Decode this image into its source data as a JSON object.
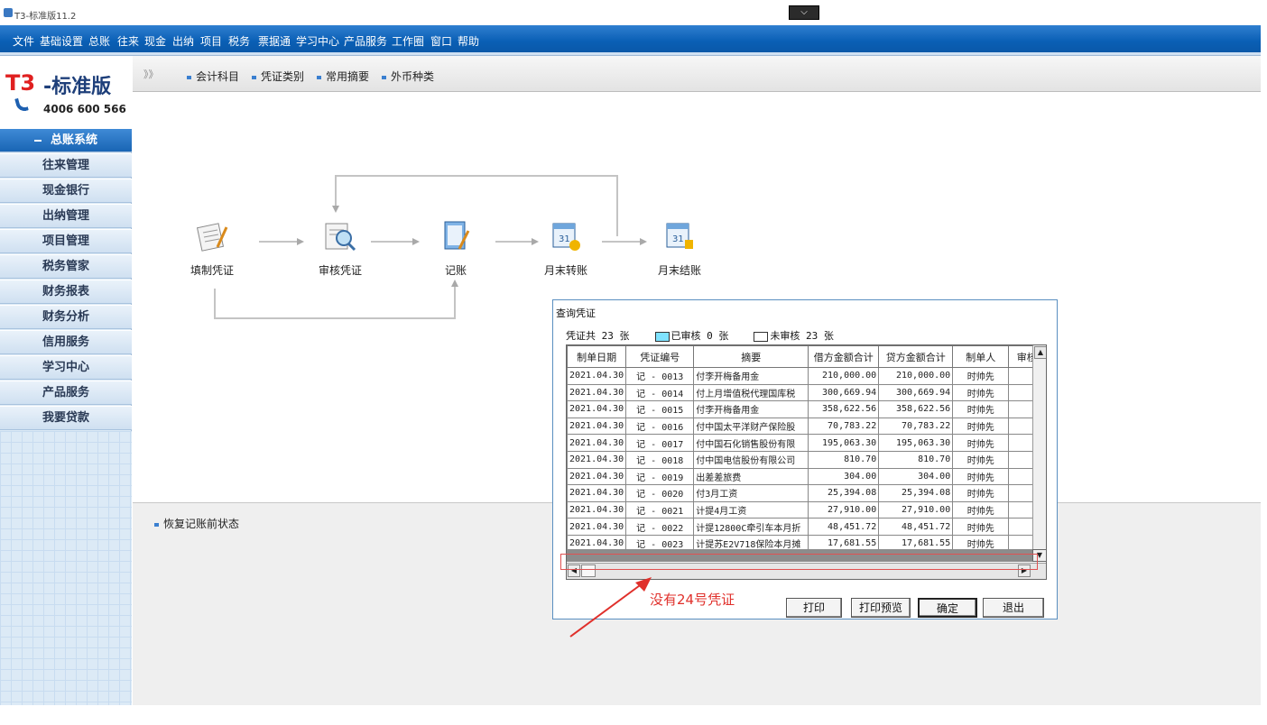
{
  "window": {
    "title": "T3-标准版11.2",
    "dropdown_glyph": "⌵"
  },
  "menu": [
    "文件",
    "基础设置",
    "总账",
    "往来",
    "现金",
    "出纳",
    "项目",
    "税务",
    "票据通",
    "学习中心",
    "产品服务",
    "工作圈",
    "窗口",
    "帮助"
  ],
  "logo": {
    "t3": "T3",
    "rest": "-标准版",
    "phone": "4006 600 566"
  },
  "sidebar": {
    "items": [
      {
        "label": "总账系统",
        "active": true
      },
      {
        "label": "往来管理"
      },
      {
        "label": "现金银行"
      },
      {
        "label": "出纳管理"
      },
      {
        "label": "项目管理"
      },
      {
        "label": "税务管家"
      },
      {
        "label": "财务报表"
      },
      {
        "label": "财务分析"
      },
      {
        "label": "信用服务"
      },
      {
        "label": "学习中心"
      },
      {
        "label": "产品服务"
      },
      {
        "label": "我要贷款"
      }
    ]
  },
  "toolbar": {
    "arrows": "》》",
    "links": [
      "会计科目",
      "凭证类别",
      "常用摘要",
      "外币种类"
    ]
  },
  "workflow": {
    "nodes": [
      "填制凭证",
      "审核凭证",
      "记账",
      "月末转账",
      "月末结账"
    ]
  },
  "lower": {
    "restore_label": "恢复记账前状态"
  },
  "dialog": {
    "title": "查询凭证",
    "stats": {
      "total": "凭证共 23 张",
      "audited": "已审核 0 张",
      "unaudited": "未审核 23 张"
    },
    "columns": [
      "制单日期",
      "凭证编号",
      "摘要",
      "借方金额合计",
      "贷方金额合计",
      "制单人",
      "审核"
    ],
    "rows": [
      [
        "2021.04.30",
        "记 - 0013",
        "付李开梅备用金",
        "210,000.00",
        "210,000.00",
        "时帅先"
      ],
      [
        "2021.04.30",
        "记 - 0014",
        "付上月增值税代理国库税",
        "300,669.94",
        "300,669.94",
        "时帅先"
      ],
      [
        "2021.04.30",
        "记 - 0015",
        "付李开梅备用金",
        "358,622.56",
        "358,622.56",
        "时帅先"
      ],
      [
        "2021.04.30",
        "记 - 0016",
        "付中国太平洋财产保险股",
        "70,783.22",
        "70,783.22",
        "时帅先"
      ],
      [
        "2021.04.30",
        "记 - 0017",
        "付中国石化销售股份有限",
        "195,063.30",
        "195,063.30",
        "时帅先"
      ],
      [
        "2021.04.30",
        "记 - 0018",
        "付中国电信股份有限公司",
        "810.70",
        "810.70",
        "时帅先"
      ],
      [
        "2021.04.30",
        "记 - 0019",
        "出差差旅费",
        "304.00",
        "304.00",
        "时帅先"
      ],
      [
        "2021.04.30",
        "记 - 0020",
        "付3月工资",
        "25,394.08",
        "25,394.08",
        "时帅先"
      ],
      [
        "2021.04.30",
        "记 - 0021",
        "计提4月工资",
        "27,910.00",
        "27,910.00",
        "时帅先"
      ],
      [
        "2021.04.30",
        "记 - 0022",
        "计提12800C牵引车本月折",
        "48,451.72",
        "48,451.72",
        "时帅先"
      ],
      [
        "2021.04.30",
        "记 - 0023",
        "计提苏E2V718保险本月摊",
        "17,681.55",
        "17,681.55",
        "时帅先"
      ]
    ],
    "buttons": [
      "打印",
      "打印预览",
      "确定",
      "退出"
    ]
  },
  "annotation": {
    "text": "没有24号凭证"
  },
  "colors": {
    "menu_blue": "#0a5fb5",
    "annotation_red": "#e0302b",
    "audited_swatch": "#7fe3ff"
  }
}
